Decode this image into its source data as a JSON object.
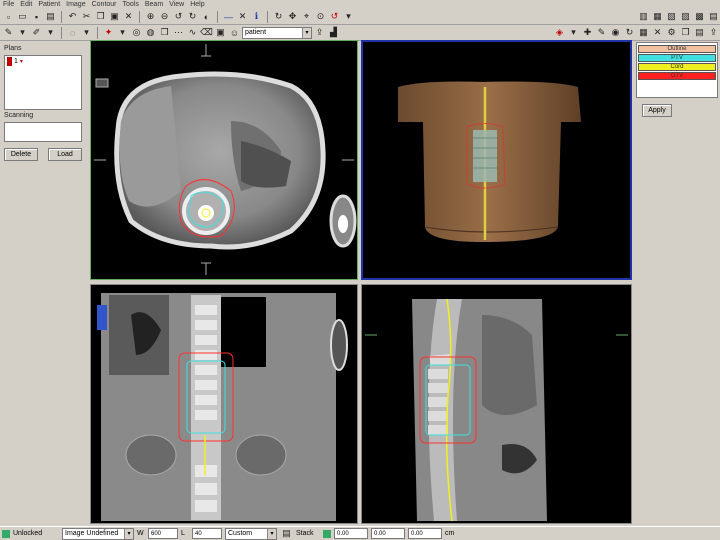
{
  "menu": [
    "File",
    "Edit",
    "Patient",
    "Image",
    "Contour",
    "Tools",
    "Beam",
    "View",
    "Help"
  ],
  "toolbar2": {
    "patient_value": "patient"
  },
  "left_panel": {
    "list_label": "Plans",
    "list_items": [
      "1"
    ],
    "second_label": "Scanning",
    "btn_left": "Delete",
    "btn_right": "Load"
  },
  "structures": {
    "items": [
      {
        "label": "Outline",
        "color": "#f0c0a0"
      },
      {
        "label": "PTV",
        "color": "#40e0e0"
      },
      {
        "label": "Cord",
        "color": "#f0f020"
      },
      {
        "label": "GTV",
        "color": "#ff2020"
      }
    ],
    "apply_button": "Apply"
  },
  "status": {
    "first": "Unlocked",
    "image_select": "Image Undefined",
    "w_label": "W",
    "w_value": "600",
    "l_label": "L",
    "l_value": "40",
    "preset": "Custom",
    "stack_label": "Stack",
    "v1": "0.00",
    "v2": "0.00",
    "v3": "0.00",
    "unit": "cm"
  },
  "colors": {
    "axial_border": "#66aa66",
    "viewport_3d_border": "#2233aa",
    "outline": "#f0c0a0",
    "ptv": "#40e0e0",
    "cord": "#f0f020",
    "gtv": "#ff2020"
  }
}
